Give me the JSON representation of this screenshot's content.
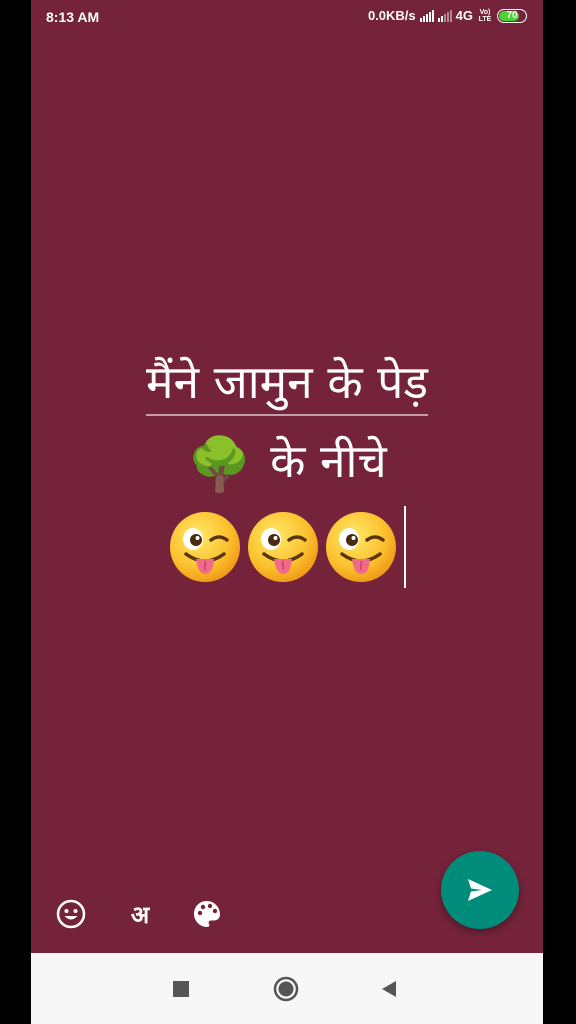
{
  "status_bar": {
    "time": "8:13 AM",
    "net_speed": "0.0KB/s",
    "network_type": "4G",
    "volte_top": "Vo)",
    "volte_bottom": "LTE",
    "battery": "70"
  },
  "status_text": {
    "line1": "मैंने जामुन के पेड़",
    "tree_emoji": "🌳",
    "line2": "के नीचे",
    "emojis": [
      "winking-face-with-tongue",
      "winking-face-with-tongue",
      "winking-face-with-tongue"
    ]
  },
  "toolbar": {
    "emoji_icon": "smiley-icon",
    "language_label": "अ",
    "palette_icon": "palette-icon",
    "send_icon": "send-icon"
  },
  "navigation": {
    "recents_icon": "square-icon",
    "home_icon": "circle-icon",
    "back_icon": "triangle-back-icon"
  },
  "colors": {
    "background": "#74233a",
    "send_button": "#008c7a",
    "nav_bar": "#f7f7f7",
    "battery_fill": "#4cd137"
  }
}
